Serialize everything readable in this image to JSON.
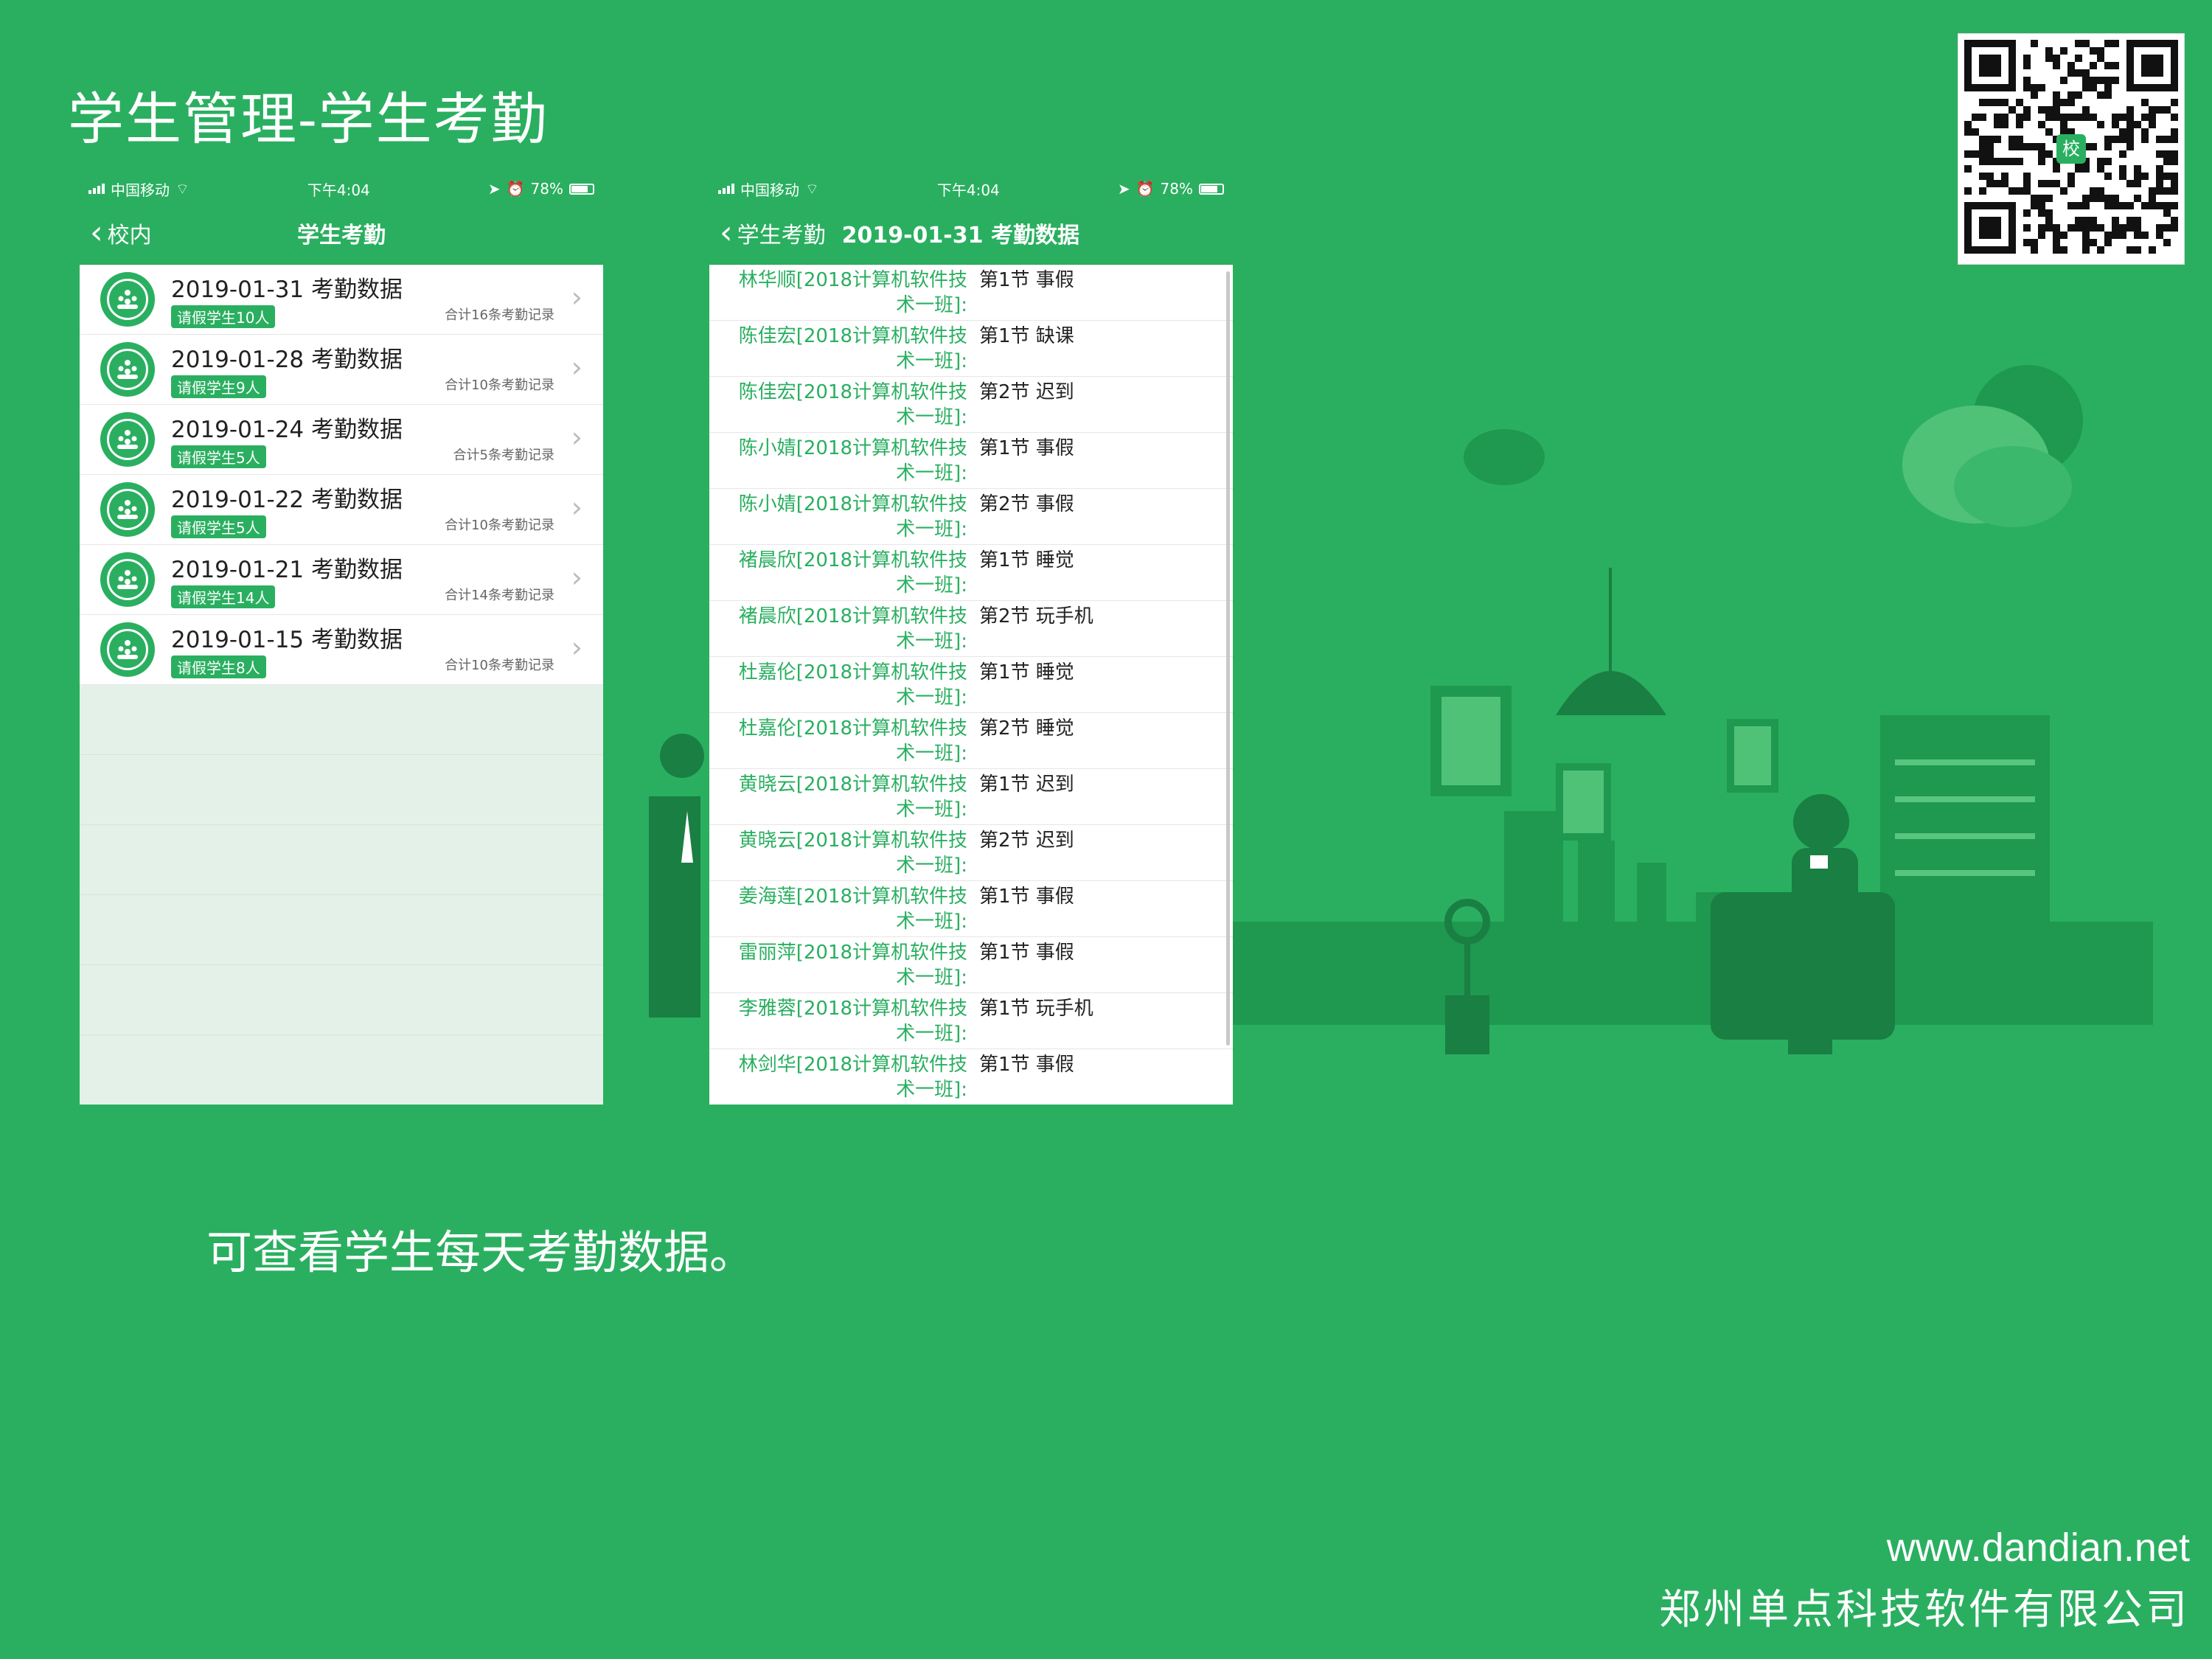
{
  "slide": {
    "title": "学生管理-学生考勤",
    "caption": "可查看学生每天考勤数据。",
    "footer_url": "www.dandian.net",
    "footer_company": "郑州单点科技软件有限公司",
    "qr_badge": "校"
  },
  "status_bar": {
    "carrier": "中国移动",
    "time": "下午4:04",
    "battery": "78%"
  },
  "screen1": {
    "back_label": "校内",
    "title": "学生考勤",
    "rows": [
      {
        "title": "2019-01-31 考勤数据",
        "badge": "请假学生10人",
        "count": "合计16条考勤记录"
      },
      {
        "title": "2019-01-28 考勤数据",
        "badge": "请假学生9人",
        "count": "合计10条考勤记录"
      },
      {
        "title": "2019-01-24 考勤数据",
        "badge": "请假学生5人",
        "count": "合计5条考勤记录"
      },
      {
        "title": "2019-01-22 考勤数据",
        "badge": "请假学生5人",
        "count": "合计10条考勤记录"
      },
      {
        "title": "2019-01-21 考勤数据",
        "badge": "请假学生14人",
        "count": "合计14条考勤记录"
      },
      {
        "title": "2019-01-15 考勤数据",
        "badge": "请假学生8人",
        "count": "合计10条考勤记录"
      }
    ]
  },
  "screen2": {
    "back_label": "学生考勤",
    "title": "2019-01-31 考勤数据",
    "records": [
      {
        "name": "林华顺[2018计算机软件技术一班]:",
        "status": "第1节 事假"
      },
      {
        "name": "陈佳宏[2018计算机软件技术一班]:",
        "status": "第1节 缺课"
      },
      {
        "name": "陈佳宏[2018计算机软件技术一班]:",
        "status": "第2节 迟到"
      },
      {
        "name": "陈小婧[2018计算机软件技术一班]:",
        "status": "第1节 事假"
      },
      {
        "name": "陈小婧[2018计算机软件技术一班]:",
        "status": "第2节 事假"
      },
      {
        "name": "褚晨欣[2018计算机软件技术一班]:",
        "status": "第1节 睡觉"
      },
      {
        "name": "褚晨欣[2018计算机软件技术一班]:",
        "status": "第2节 玩手机"
      },
      {
        "name": "杜嘉伦[2018计算机软件技术一班]:",
        "status": "第1节 睡觉"
      },
      {
        "name": "杜嘉伦[2018计算机软件技术一班]:",
        "status": "第2节 睡觉"
      },
      {
        "name": "黄晓云[2018计算机软件技术一班]:",
        "status": "第1节 迟到"
      },
      {
        "name": "黄晓云[2018计算机软件技术一班]:",
        "status": "第2节 迟到"
      },
      {
        "name": "姜海莲[2018计算机软件技术一班]:",
        "status": "第1节 事假"
      },
      {
        "name": "雷丽萍[2018计算机软件技术一班]:",
        "status": "第1节 事假"
      },
      {
        "name": "李雅蓉[2018计算机软件技术一班]:",
        "status": "第1节 玩手机"
      },
      {
        "name": "林剑华[2018计算机软件技术一班]:",
        "status": "第1节 事假"
      }
    ]
  },
  "colors": {
    "brand_green": "#2aaf60",
    "dark_green": "#1e8a48",
    "pale_green": "#e3f1e8"
  }
}
